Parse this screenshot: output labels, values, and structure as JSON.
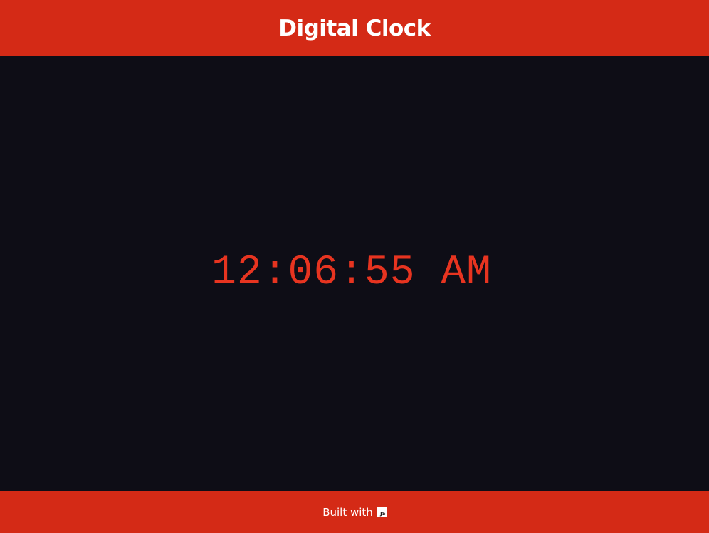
{
  "header": {
    "title": "Digital Clock"
  },
  "clock": {
    "time": "12:06:55 AM"
  },
  "footer": {
    "text": "Built with",
    "icon": "javascript-icon",
    "icon_label": "JS"
  },
  "colors": {
    "accent": "#d42a16",
    "background": "#0e0d16",
    "clock_text": "#e73420",
    "text": "#ffffff"
  }
}
